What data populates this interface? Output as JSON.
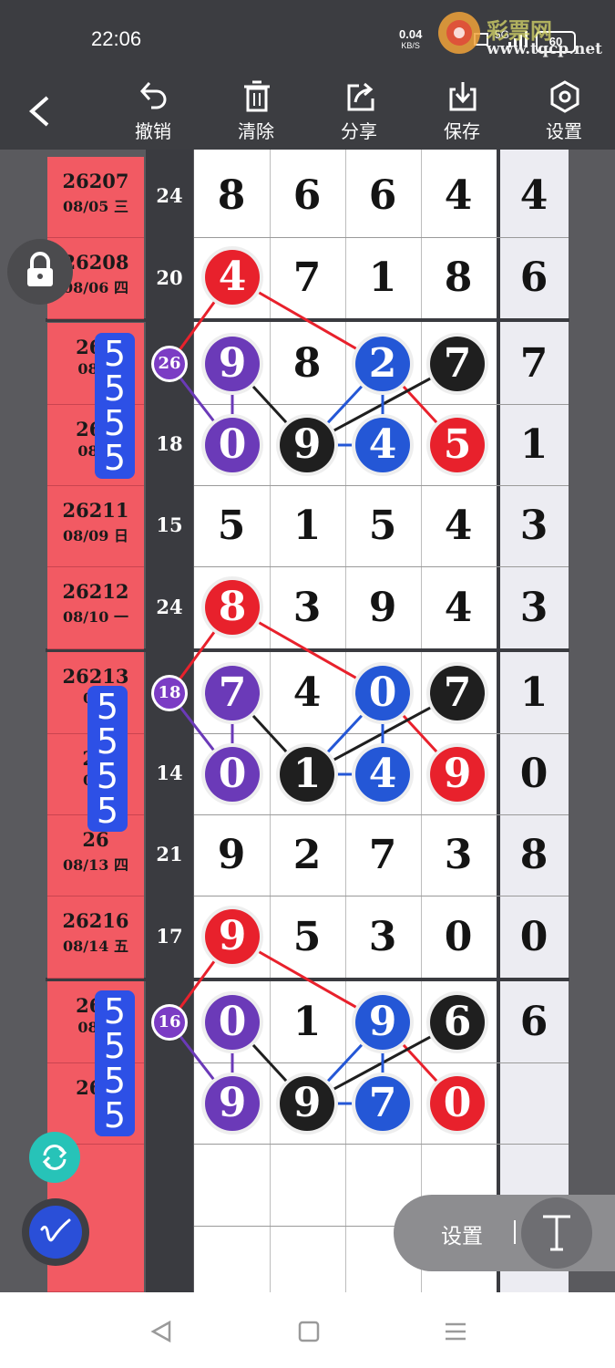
{
  "status": {
    "time": "22:06",
    "net_speed": "0.04",
    "net_unit": "KB/S",
    "signal": "5G",
    "battery": "60"
  },
  "watermark": {
    "text": "www.tqcp.net",
    "logo_text": "彩票网"
  },
  "toolbar": {
    "back": "back",
    "undo": "撤销",
    "clear": "清除",
    "share": "分享",
    "save": "保存",
    "settings": "设置"
  },
  "rows": [
    {
      "issue": "26207",
      "date": "08/05 三",
      "sum": "24",
      "digits": [
        "8",
        "6",
        "6",
        "4"
      ],
      "extra": "4"
    },
    {
      "issue": "26208",
      "date": "08/06 四",
      "sum": "20",
      "digits": [
        "4",
        "7",
        "1",
        "8"
      ],
      "extra": "6"
    },
    {
      "issue": "262",
      "date": "08/0",
      "sum": "26",
      "digits": [
        "9",
        "8",
        "2",
        "7"
      ],
      "extra": "7"
    },
    {
      "issue": "262",
      "date": "08/0",
      "sum": "18",
      "digits": [
        "0",
        "9",
        "4",
        "5"
      ],
      "extra": "1"
    },
    {
      "issue": "26211",
      "date": "08/09 日",
      "sum": "15",
      "digits": [
        "5",
        "1",
        "5",
        "4"
      ],
      "extra": "3"
    },
    {
      "issue": "26212",
      "date": "08/10 一",
      "sum": "24",
      "digits": [
        "8",
        "3",
        "9",
        "4"
      ],
      "extra": "3"
    },
    {
      "issue": "26213",
      "date": "08/",
      "sum": "18",
      "digits": [
        "7",
        "4",
        "0",
        "7"
      ],
      "extra": "1"
    },
    {
      "issue": "26",
      "date": "08/",
      "sum": "14",
      "digits": [
        "0",
        "1",
        "4",
        "9"
      ],
      "extra": "0"
    },
    {
      "issue": "26",
      "date": "08/13 四",
      "sum": "21",
      "digits": [
        "9",
        "2",
        "7",
        "3"
      ],
      "extra": "8"
    },
    {
      "issue": "26216",
      "date": "08/14 五",
      "sum": "17",
      "digits": [
        "9",
        "5",
        "3",
        "0"
      ],
      "extra": "0"
    },
    {
      "issue": "262",
      "date": "08/1",
      "sum": "16",
      "digits": [
        "0",
        "1",
        "9",
        "6"
      ],
      "extra": "6"
    },
    {
      "issue": "262",
      "date": "",
      "sum": "",
      "digits": [
        "9",
        "9",
        "7",
        "0"
      ],
      "extra": ""
    }
  ],
  "patterns": [
    {
      "digits": [
        "5",
        "5",
        "5",
        "5"
      ]
    },
    {
      "digits": [
        "5",
        "5",
        "5",
        "5"
      ]
    },
    {
      "digits": [
        "5",
        "5",
        "5",
        "5"
      ]
    }
  ],
  "floating": {
    "settings_label": "设置"
  },
  "colors": {
    "red": "#e8212c",
    "purple": "#6b3ab8",
    "blue": "#2457d6",
    "black": "#1f1f1f",
    "date_bg": "#f25a63",
    "pattern_bg": "#2d50e6"
  }
}
